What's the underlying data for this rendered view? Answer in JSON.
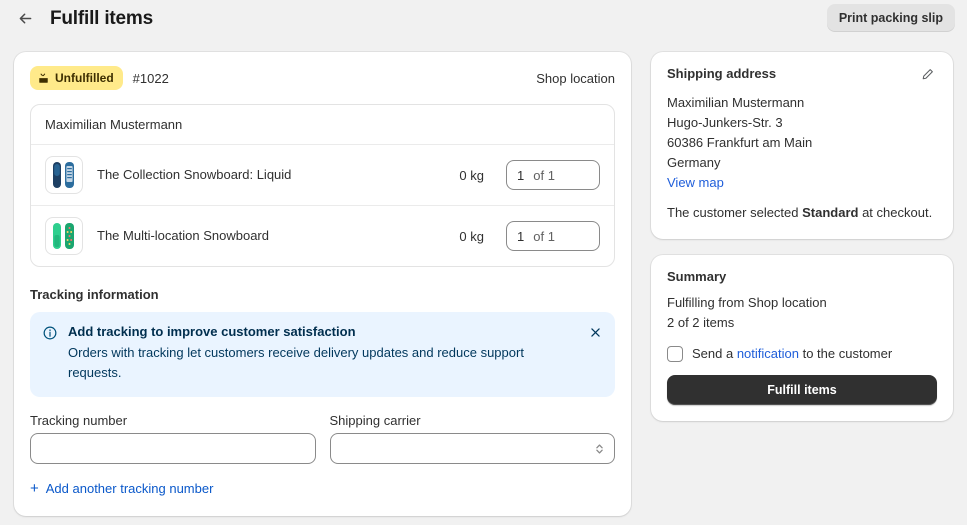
{
  "header": {
    "back_icon": "arrow-left-icon",
    "title": "Fulfill items",
    "print_label": "Print packing slip"
  },
  "fulfillment": {
    "status_badge": {
      "icon": "unfulfilled-package-icon",
      "label": "Unfulfilled",
      "bg_color": "#ffea8a"
    },
    "order_number": "#1022",
    "location": "Shop location",
    "customer_name": "Maximilian Mustermann",
    "items": [
      {
        "title": "The Collection Snowboard: Liquid",
        "weight": "0 kg",
        "qty_value": "1",
        "qty_of": "of 1",
        "thumb_color_a": "#1d3f63",
        "thumb_color_b": "#2c6d9e"
      },
      {
        "title": "The Multi-location Snowboard",
        "weight": "0 kg",
        "qty_value": "1",
        "qty_of": "of 1",
        "thumb_color_a": "#2ecf8e",
        "thumb_color_b": "#1aa66f"
      }
    ]
  },
  "tracking": {
    "section_title": "Tracking information",
    "banner": {
      "icon": "info-circle-icon",
      "title": "Add tracking to improve customer satisfaction",
      "text": "Orders with tracking let customers receive delivery updates and reduce support requests.",
      "close_icon": "close-icon",
      "bg_color": "#eaf4ff"
    },
    "number_label": "Tracking number",
    "number_value": "",
    "number_placeholder": "",
    "carrier_label": "Shipping carrier",
    "carrier_value": "",
    "carrier_options": [
      ""
    ],
    "carrier_caret_icon": "chevron-up-down-icon",
    "add_another_label": "Add another tracking number",
    "add_another_icon": "plus-icon"
  },
  "shipping_address": {
    "title": "Shipping address",
    "edit_icon": "pencil-icon",
    "lines": [
      "Maximilian Mustermann",
      "Hugo-Junkers-Str. 3",
      "60386 Frankfurt am Main",
      "Germany"
    ],
    "view_map_label": "View map",
    "note_prefix": "The customer selected ",
    "note_bold": "Standard",
    "note_suffix": " at checkout."
  },
  "summary": {
    "title": "Summary",
    "fulfilling_from": "Fulfilling from Shop location",
    "item_count": "2 of 2 items",
    "notify_prefix": "Send a ",
    "notify_link": "notification",
    "notify_suffix": " to the customer",
    "notify_checked": false,
    "fulfill_button": "Fulfill items",
    "button_color": "#303030"
  }
}
